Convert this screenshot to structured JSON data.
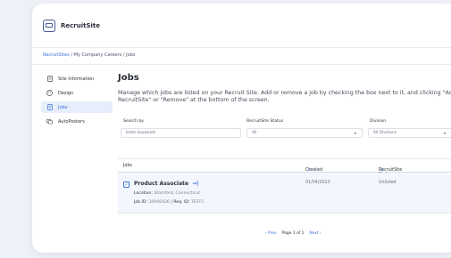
{
  "app": {
    "title": "RecruitSite"
  },
  "breadcrumb": {
    "root": "RecruitSites",
    "middle": "My Company Careers",
    "current": "Jobs",
    "sep": " / "
  },
  "sidebar": {
    "items": [
      {
        "label": "Site Information",
        "icon": "document-icon"
      },
      {
        "label": "Design",
        "icon": "palette-icon"
      },
      {
        "label": "Jobs",
        "icon": "jobs-icon",
        "active": true
      },
      {
        "label": "AutoPosters",
        "icon": "autoposter-icon"
      }
    ]
  },
  "main": {
    "title": "Jobs",
    "description": "Manage which jobs are listed on your Recruit Site. Add or remove a job by checking the box next to it, and clicking \"Add RecruitSite\" or \"Remove\" at the bottom of the screen."
  },
  "filters": {
    "search": {
      "label": "Search by",
      "placeholder": "Enter keywords"
    },
    "status": {
      "label": "RecruitSite Status",
      "value": "All"
    },
    "division": {
      "label": "Division",
      "value": "All Divisions"
    }
  },
  "table": {
    "headers": {
      "jobs": "Jobs",
      "created": "Created",
      "status": "RecruitSite Status",
      "sort_glyph": "⇕"
    },
    "rows": [
      {
        "title": "Product Associate",
        "link_glyph": "→|",
        "location_label": "Location:",
        "location": "Stamford, Connecticut",
        "jobid_label": "Job ID:",
        "jobid": "30906426",
        "reqid_label": "| Req. ID:",
        "reqid": "TEST1",
        "created": "01/04/2023",
        "status": "Unlisted",
        "checked": true
      }
    ]
  },
  "pager": {
    "prev": "‹ Prev",
    "info": "Page 1 of 1",
    "next": "Next ›"
  },
  "colors": {
    "accent": "#3b6fd4",
    "selected_row": "#f3f6fd",
    "active_nav": "#e6eefc"
  }
}
